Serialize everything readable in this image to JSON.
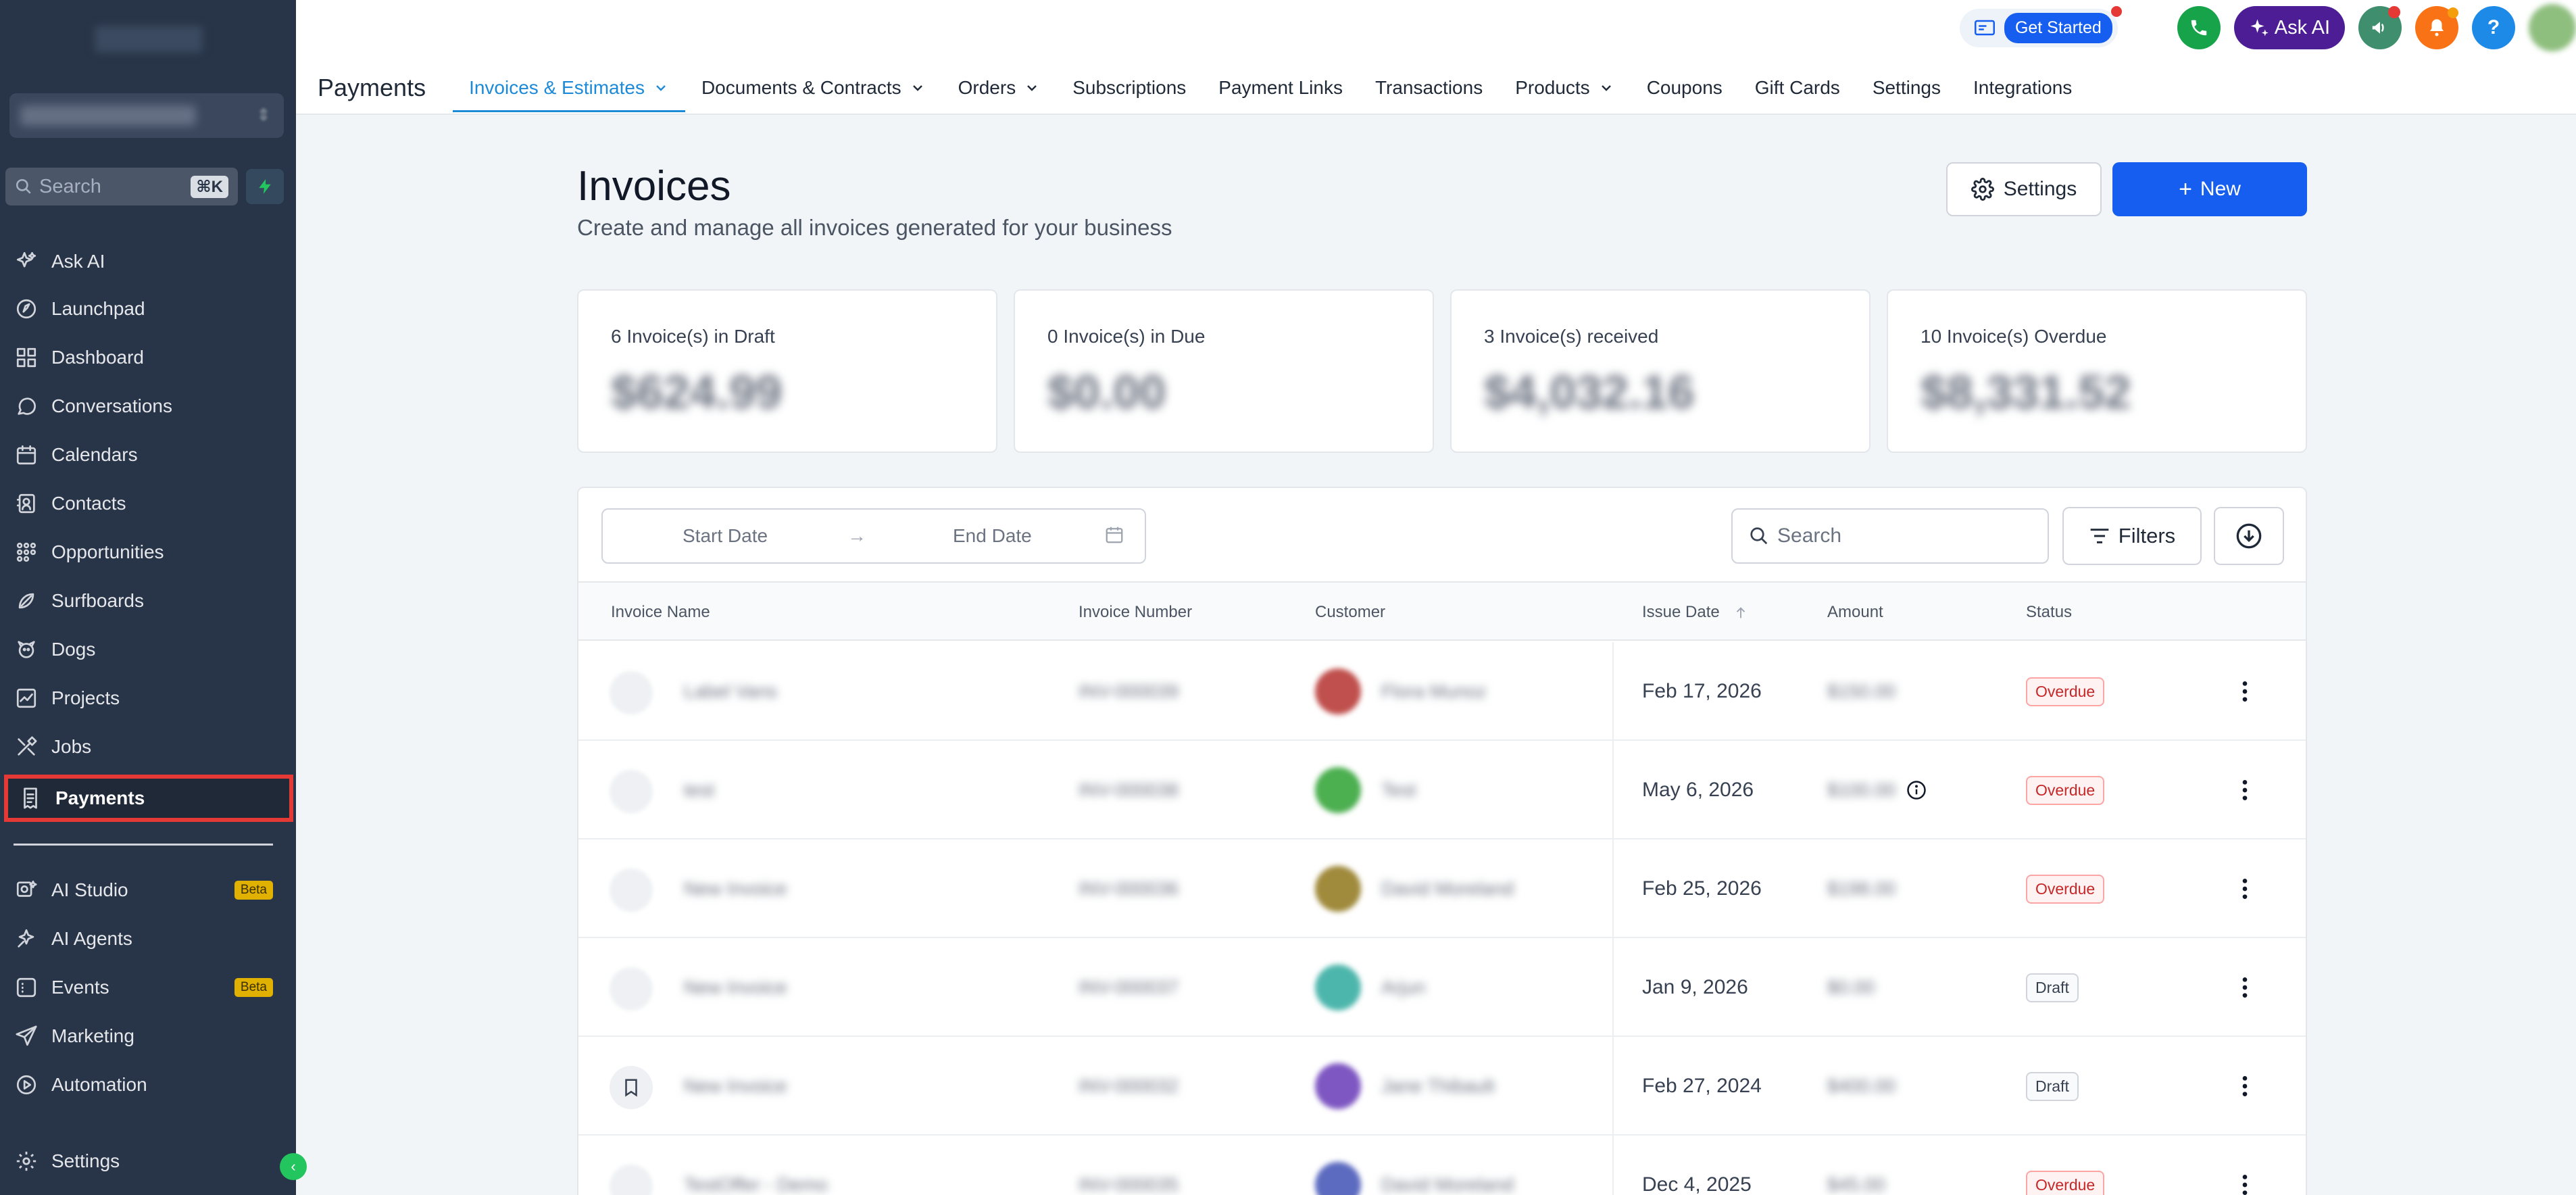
{
  "sidebar": {
    "search_placeholder": "Search",
    "search_shortcut": "⌘K",
    "items": [
      {
        "label": "Ask AI",
        "icon": "sparkle-icon"
      },
      {
        "label": "Launchpad",
        "icon": "rocket-icon"
      },
      {
        "label": "Dashboard",
        "icon": "dashboard-icon"
      },
      {
        "label": "Conversations",
        "icon": "chat-icon"
      },
      {
        "label": "Calendars",
        "icon": "calendar-icon"
      },
      {
        "label": "Contacts",
        "icon": "contacts-icon"
      },
      {
        "label": "Opportunities",
        "icon": "opportunities-icon"
      },
      {
        "label": "Surfboards",
        "icon": "surfboard-icon"
      },
      {
        "label": "Dogs",
        "icon": "dog-icon"
      },
      {
        "label": "Projects",
        "icon": "projects-icon"
      },
      {
        "label": "Jobs",
        "icon": "tools-icon"
      },
      {
        "label": "Payments",
        "icon": "receipt-icon",
        "active": true
      }
    ],
    "items2": [
      {
        "label": "AI Studio",
        "icon": "ai-studio-icon",
        "badge": "Beta"
      },
      {
        "label": "AI Agents",
        "icon": "ai-agents-icon"
      },
      {
        "label": "Events",
        "icon": "events-icon",
        "badge": "Beta"
      },
      {
        "label": "Marketing",
        "icon": "send-icon"
      },
      {
        "label": "Automation",
        "icon": "automation-icon"
      }
    ],
    "settings_label": "Settings",
    "collapse_glyph": "‹"
  },
  "topbar": {
    "get_started": "Get Started",
    "ask_ai": "Ask AI",
    "help": "?"
  },
  "nav": {
    "title": "Payments",
    "tabs": [
      {
        "label": "Invoices & Estimates",
        "dropdown": true,
        "active": true
      },
      {
        "label": "Documents & Contracts",
        "dropdown": true
      },
      {
        "label": "Orders",
        "dropdown": true
      },
      {
        "label": "Subscriptions"
      },
      {
        "label": "Payment Links"
      },
      {
        "label": "Transactions"
      },
      {
        "label": "Products",
        "dropdown": true
      },
      {
        "label": "Coupons"
      },
      {
        "label": "Gift Cards"
      },
      {
        "label": "Settings"
      },
      {
        "label": "Integrations"
      }
    ]
  },
  "page": {
    "title": "Invoices",
    "subtitle": "Create and manage all invoices generated for your business",
    "settings_button": "Settings",
    "new_button": "New",
    "new_plus": "+"
  },
  "stats": [
    {
      "label": "6 Invoice(s) in Draft",
      "value": "$624.99"
    },
    {
      "label": "0 Invoice(s) in Due",
      "value": "$0.00"
    },
    {
      "label": "3 Invoice(s) received",
      "value": "$4,032.16"
    },
    {
      "label": "10 Invoice(s) Overdue",
      "value": "$8,331.52"
    }
  ],
  "filters": {
    "start_placeholder": "Start Date",
    "end_placeholder": "End Date",
    "arrow": "→",
    "search_placeholder": "Search",
    "filters_label": "Filters"
  },
  "table": {
    "headers": {
      "name": "Invoice Name",
      "number": "Invoice Number",
      "customer": "Customer",
      "issue_date": "Issue Date",
      "amount": "Amount",
      "status": "Status"
    },
    "rows": [
      {
        "name": "Label Vans",
        "number": "INV-000039",
        "customer": "Flora Munoz",
        "avatar_color": "#c0504d",
        "issue_date": "Feb 17, 2026",
        "amount": "$150.00",
        "status": "Overdue"
      },
      {
        "name": "test",
        "number": "INV-000038",
        "customer": "Test",
        "avatar_color": "#4caf50",
        "issue_date": "May 6, 2026",
        "amount": "$100.00",
        "status": "Overdue",
        "info": true
      },
      {
        "name": "New Invoice",
        "number": "INV-000036",
        "customer": "David Moreland",
        "avatar_color": "#a08a3c",
        "issue_date": "Feb 25, 2026",
        "amount": "$198.00",
        "status": "Overdue"
      },
      {
        "name": "New Invoice",
        "number": "INV-000037",
        "customer": "Arjun",
        "avatar_color": "#4db6ac",
        "issue_date": "Jan 9, 2026",
        "amount": "$0.00",
        "status": "Draft"
      },
      {
        "name": "New Invoice",
        "number": "INV-000032",
        "customer": "Jane Thibault",
        "avatar_color": "#7e57c2",
        "issue_date": "Feb 27, 2024",
        "amount": "$400.00",
        "status": "Draft",
        "clear_icon": true
      },
      {
        "name": "TestOffer - Demo",
        "number": "INV-000035",
        "customer": "David Moreland",
        "avatar_color": "#5c6bc0",
        "issue_date": "Dec 4, 2025",
        "amount": "$45.00",
        "status": "Overdue"
      }
    ]
  }
}
